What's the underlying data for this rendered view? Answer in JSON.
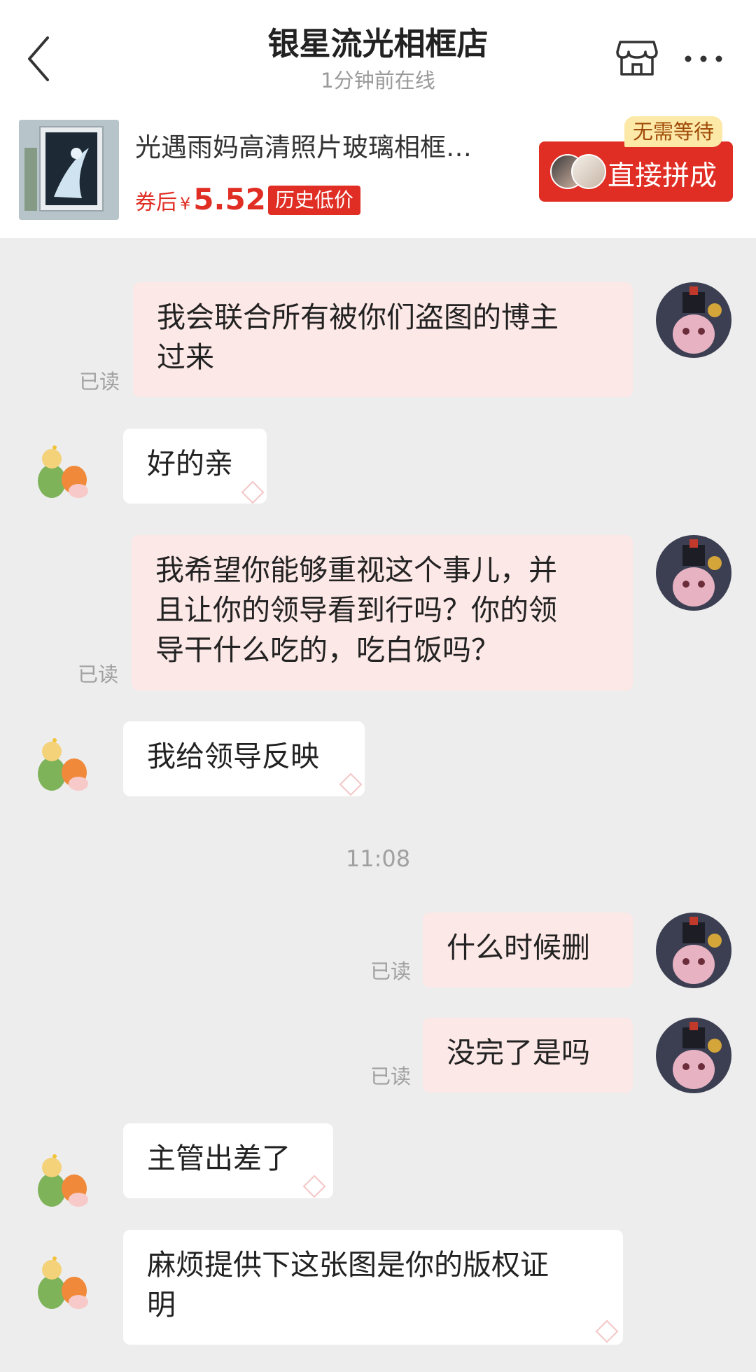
{
  "header": {
    "title": "银星流光相框店",
    "status": "1分钟前在线"
  },
  "product": {
    "title": "光遇雨妈高清照片玻璃相框…",
    "price_label": "券后",
    "price_currency": "¥",
    "price_value": "5.52",
    "badge": "历史低价",
    "nowait": "无需等待",
    "group_button": "直接拼成"
  },
  "messages": [
    {
      "from": "me",
      "lines": [
        "我会联合所有被你们盗图的博主",
        "过来"
      ],
      "read": "已读"
    },
    {
      "from": "them",
      "lines": [
        "好的亲"
      ]
    },
    {
      "from": "me",
      "lines": [
        "我希望你能够重视这个事儿，并",
        "且让你的领导看到行吗？你的领",
        "导干什么吃的，吃白饭吗？"
      ],
      "read": "已读"
    },
    {
      "from": "them",
      "lines": [
        "我给领导反映"
      ]
    },
    {
      "from": "me",
      "lines": [
        "什么时候删"
      ],
      "read": "已读"
    },
    {
      "from": "me",
      "lines": [
        "没完了是吗"
      ],
      "read": "已读"
    },
    {
      "from": "them",
      "lines": [
        "主管出差了"
      ]
    },
    {
      "from": "them",
      "lines": [
        "麻烦提供下这张图是你的版权证",
        "明"
      ]
    }
  ],
  "time_divider": "11:08",
  "colors": {
    "accent": "#e02e24",
    "my_bubble": "#fce8e6",
    "their_bubble": "#ffffff",
    "background": "#ededed"
  }
}
